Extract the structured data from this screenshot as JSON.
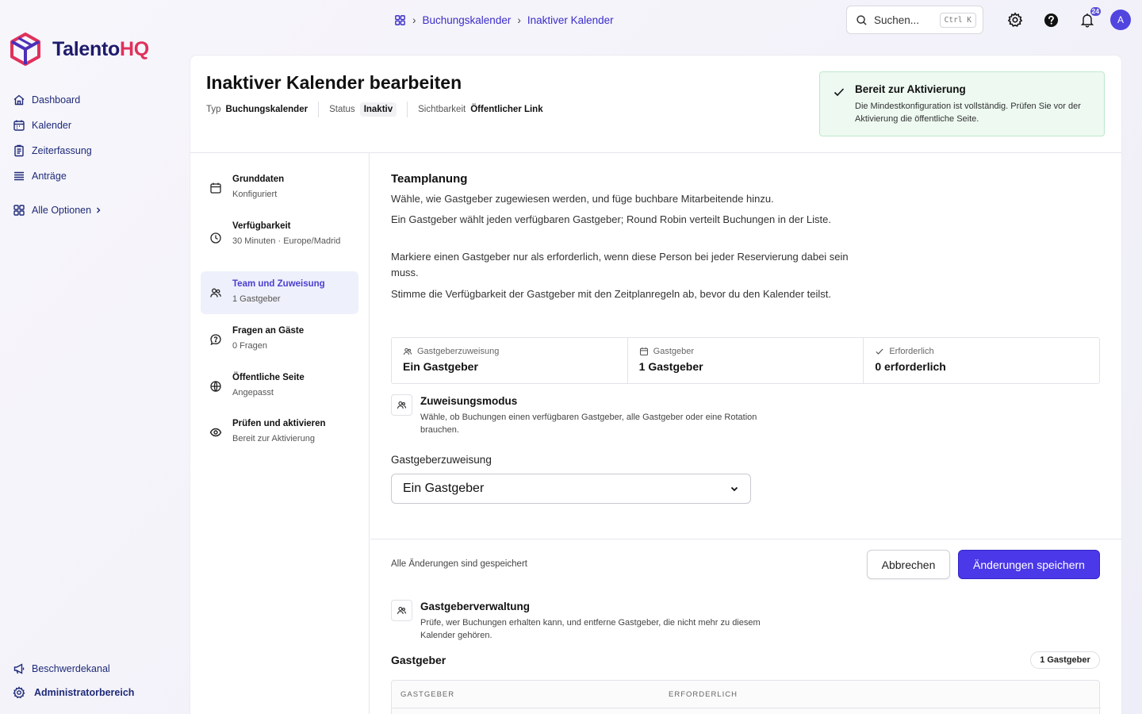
{
  "brand": {
    "name_main": "Talento",
    "name_accent": "HQ",
    "primary": "#4b38e8",
    "accent": "#e0315b"
  },
  "sidebar": {
    "items": [
      {
        "label": "Dashboard",
        "icon": "home-icon"
      },
      {
        "label": "Kalender",
        "icon": "calendar-icon"
      },
      {
        "label": "Zeiterfassung",
        "icon": "clipboard-icon"
      },
      {
        "label": "Anträge",
        "icon": "list-icon"
      }
    ],
    "all_options": "Alle Optionen",
    "bottom": [
      {
        "label": "Beschwerdekanal",
        "icon": "megaphone-icon"
      },
      {
        "label": "Administratorbereich",
        "icon": "gear-icon"
      }
    ]
  },
  "breadcrumb": {
    "items": [
      "Buchungskalender",
      "Inaktiver Kalender"
    ]
  },
  "search": {
    "placeholder": "Suchen...",
    "shortcut": "Ctrl K"
  },
  "notifications": {
    "count": "24"
  },
  "user": {
    "initial": "A"
  },
  "page": {
    "title": "Inaktiver Kalender bearbeiten",
    "meta": [
      {
        "key": "Typ",
        "value": "Buchungskalender"
      },
      {
        "key": "Status",
        "value": "Inaktiv"
      },
      {
        "key": "Sichtbarkeit",
        "value": "Öffentlicher Link"
      }
    ]
  },
  "ready_banner": {
    "title": "Bereit zur Aktivierung",
    "text": "Die Mindestkonfiguration ist vollständig. Prüfen Sie vor der Aktivierung die öffentliche Seite."
  },
  "steps": [
    {
      "title": "Grunddaten",
      "subtitle": "Konfiguriert",
      "icon": "calendar-icon"
    },
    {
      "title": "Verfügbarkeit",
      "subtitle": "30 Minuten · Europe/Madrid",
      "icon": "clock-icon"
    },
    {
      "title": "Team und Zuweisung",
      "subtitle": "1 Gastgeber",
      "icon": "users-icon",
      "active": true
    },
    {
      "title": "Fragen an Gäste",
      "subtitle": "0 Fragen",
      "icon": "question-bubble-icon"
    },
    {
      "title": "Öffentliche Seite",
      "subtitle": "Angepasst",
      "icon": "globe-icon"
    },
    {
      "title": "Prüfen und aktivieren",
      "subtitle": "Bereit zur Aktivierung",
      "icon": "eye-icon"
    }
  ],
  "team": {
    "title": "Teamplanung",
    "paragraphs": [
      "Wähle, wie Gastgeber zugewiesen werden, und füge buchbare Mitarbeitende hinzu.",
      "Ein Gastgeber wählt jeden verfügbaren Gastgeber; Round Robin verteilt Buchungen in der Liste.",
      "Markiere einen Gastgeber nur als erforderlich, wenn diese Person bei jeder Reservierung dabei sein muss.",
      "Stimme die Verfügbarkeit der Gastgeber mit den Zeitplanregeln ab, bevor du den Kalender teilst."
    ],
    "stats": [
      {
        "label": "Gastgeberzuweisung",
        "value": "Ein Gastgeber",
        "icon": "users-icon"
      },
      {
        "label": "Gastgeber",
        "value": "1 Gastgeber",
        "icon": "calendar-icon"
      },
      {
        "label": "Erforderlich",
        "value": "0 erforderlich",
        "icon": "check-icon"
      }
    ],
    "mode": {
      "title": "Zuweisungsmodus",
      "text": "Wähle, ob Buchungen einen verfügbaren Gastgeber, alle Gastgeber oder eine Rotation brauchen."
    },
    "assignment_label": "Gastgeberzuweisung",
    "assignment_value": "Ein Gastgeber"
  },
  "footer": {
    "saved_text": "Alle Änderungen sind gespeichert",
    "cancel_label": "Abbrechen",
    "save_label": "Änderungen speichern"
  },
  "hosts": {
    "mgmt_title": "Gastgeberverwaltung",
    "mgmt_text": "Prüfe, wer Buchungen erhalten kann, und entferne Gastgeber, die nicht mehr zu diesem Kalender gehören.",
    "title": "Gastgeber",
    "badge": "1 Gastgeber",
    "columns": [
      "GASTGEBER",
      "ERFORDERLICH"
    ]
  }
}
